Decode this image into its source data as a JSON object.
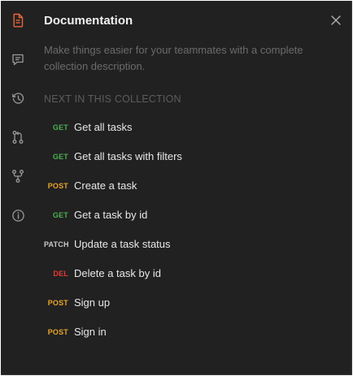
{
  "sidebar": {
    "icons": [
      {
        "name": "documentation-icon",
        "active": true
      },
      {
        "name": "comments-icon",
        "active": false
      },
      {
        "name": "history-icon",
        "active": false
      },
      {
        "name": "pull-request-icon",
        "active": false
      },
      {
        "name": "fork-icon",
        "active": false
      },
      {
        "name": "info-icon",
        "active": false
      }
    ]
  },
  "panel": {
    "title": "Documentation",
    "description": "Make things easier for your teammates with a complete collection description.",
    "section_heading": "NEXT IN THIS COLLECTION",
    "close_icon": "close-icon"
  },
  "requests": [
    {
      "method": "GET",
      "name": "Get all tasks"
    },
    {
      "method": "GET",
      "name": "Get all tasks with filters"
    },
    {
      "method": "POST",
      "name": "Create a task"
    },
    {
      "method": "GET",
      "name": "Get a task by id"
    },
    {
      "method": "PATCH",
      "name": "Update a task status"
    },
    {
      "method": "DEL",
      "name": "Delete a task by id"
    },
    {
      "method": "POST",
      "name": "Sign up"
    },
    {
      "method": "POST",
      "name": "Sign in"
    }
  ],
  "colors": {
    "background": "#212121",
    "active_icon": "#e8673a",
    "inactive_icon": "#9a9a9a",
    "GET": "#4caf50",
    "POST": "#e8a52c",
    "PATCH": "#c8c8c8",
    "DEL": "#e53935"
  }
}
